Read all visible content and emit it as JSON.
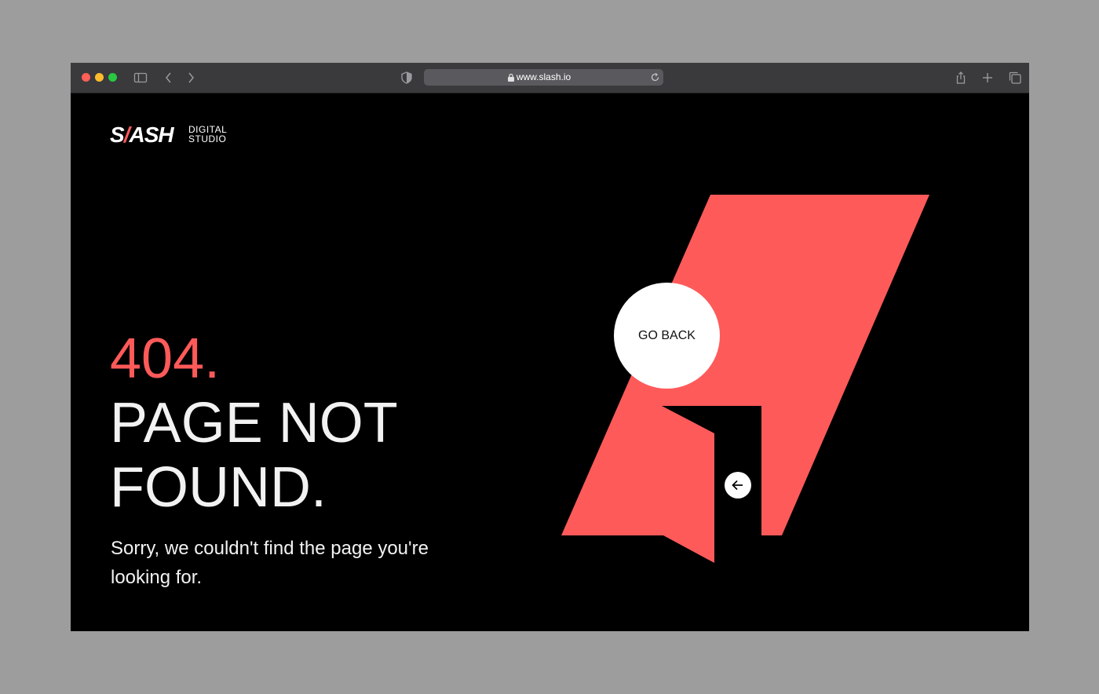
{
  "browser": {
    "url": "www.slash.io",
    "icons": [
      "sidebar-icon",
      "back-chevron-icon",
      "forward-chevron-icon",
      "shield-icon",
      "lock-icon",
      "reload-icon",
      "share-icon",
      "new-tab-icon",
      "tabs-overview-icon"
    ]
  },
  "brand": {
    "name_start": "S",
    "name_slash": "/",
    "name_end": "ASH",
    "tagline_line1": "DIGITAL",
    "tagline_line2": "STUDIO"
  },
  "error": {
    "code": "404.",
    "title_line1": "PAGE NOT",
    "title_line2": "FOUND.",
    "description": "Sorry, we couldn't find the page you're looking for."
  },
  "actions": {
    "go_back_label": "GO BACK",
    "arrow_icon": "arrow-left-icon"
  },
  "colors": {
    "accent": "#ff5a5a",
    "background": "#000000",
    "text": "#f2f2f2"
  }
}
